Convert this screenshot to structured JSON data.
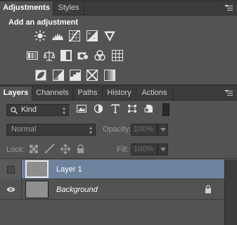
{
  "adjustments_panel": {
    "tabs": [
      {
        "label": "Adjustments",
        "active": true
      },
      {
        "label": "Styles",
        "active": false
      }
    ],
    "heading": "Add an adjustment",
    "rows": [
      [
        "brightness-contrast-icon",
        "levels-icon",
        "curves-icon",
        "exposure-icon",
        "vibrance-icon"
      ],
      [
        "hue-saturation-icon",
        "color-balance-icon",
        "black-white-icon",
        "photo-filter-icon",
        "channel-mixer-icon",
        "color-lookup-icon"
      ],
      [
        "invert-icon",
        "posterize-icon",
        "threshold-icon",
        "selective-color-icon",
        "gradient-map-icon"
      ]
    ]
  },
  "layers_panel": {
    "tabs": [
      {
        "label": "Layers",
        "active": true
      },
      {
        "label": "Channels",
        "active": false
      },
      {
        "label": "Paths",
        "active": false
      },
      {
        "label": "History",
        "active": false
      },
      {
        "label": "Actions",
        "active": false
      }
    ],
    "filter": {
      "kind_label": "Kind",
      "icons": [
        "pixel-layer-filter-icon",
        "adjustment-layer-filter-icon",
        "type-layer-filter-icon",
        "shape-layer-filter-icon",
        "smart-object-filter-icon"
      ]
    },
    "blend_mode": "Normal",
    "opacity_label": "Opacity:",
    "opacity_value": "100%",
    "lock_label": "Lock:",
    "fill_label": "Fill:",
    "fill_value": "100%",
    "layers": [
      {
        "name": "Layer 1",
        "visible": false,
        "selected": true,
        "locked": false
      },
      {
        "name": "Background",
        "visible": true,
        "selected": false,
        "locked": true
      }
    ]
  },
  "colors": {
    "panel_bg": "#535353",
    "tab_bg": "#3c3c3c",
    "selected_row": "#6d829c",
    "field_bg": "#3a3a3a"
  }
}
